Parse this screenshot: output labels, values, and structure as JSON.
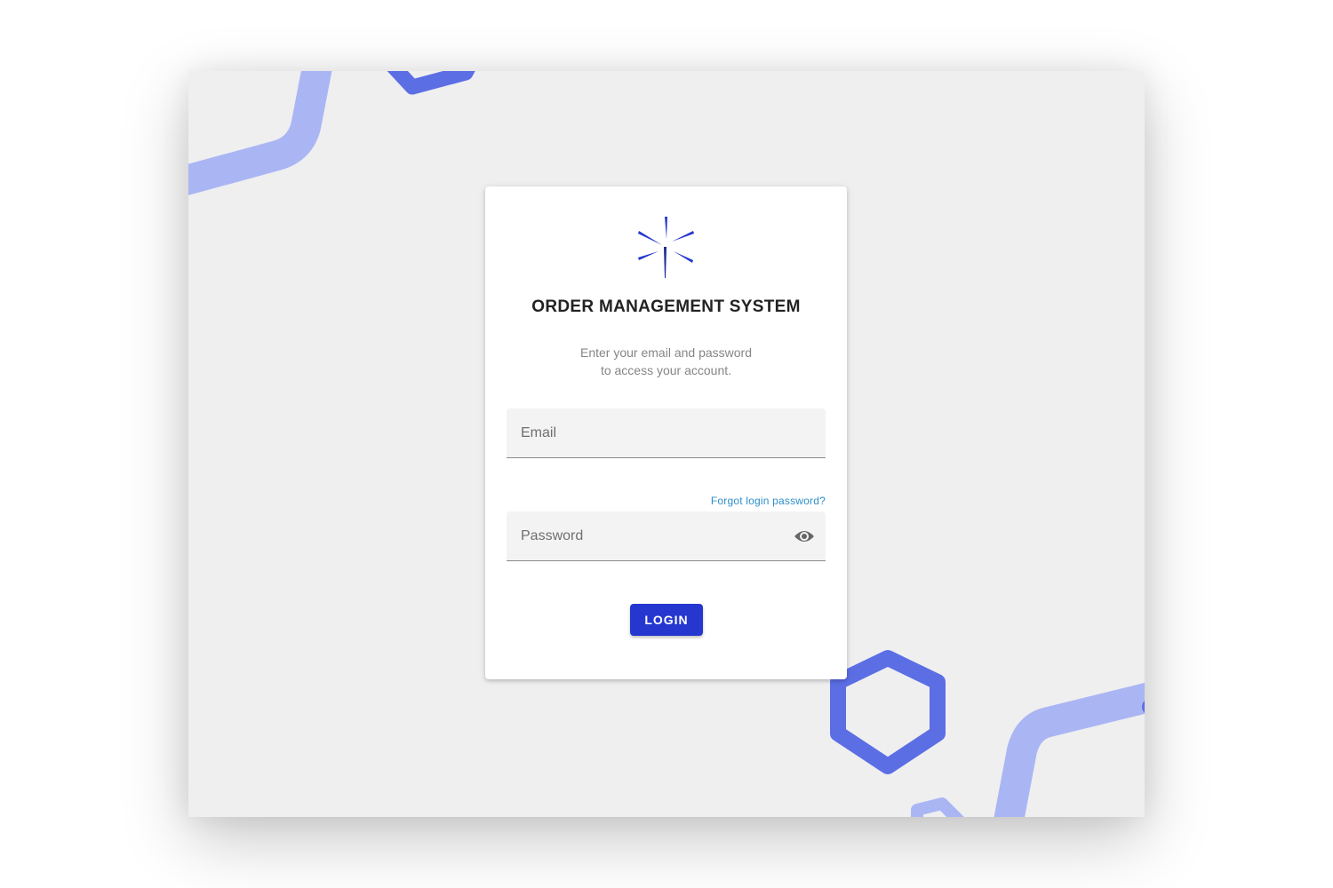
{
  "app": {
    "title": "ORDER MANAGEMENT SYSTEM",
    "subtitle_line1": "Enter your email and password",
    "subtitle_line2": "to access your account.",
    "logo_icon": "starburst-logo-icon"
  },
  "form": {
    "email": {
      "placeholder": "Email",
      "value": ""
    },
    "password": {
      "placeholder": "Password",
      "value": "",
      "toggle_icon": "eye-icon"
    },
    "forgot_link": "Forgot login password?",
    "login_label": "LOGIN"
  },
  "colors": {
    "accent": "#2537cf",
    "link": "#2e8fc9",
    "decor_light": "#aab6f4",
    "decor_dark": "#5c6ee4",
    "background": "#efeff0"
  }
}
